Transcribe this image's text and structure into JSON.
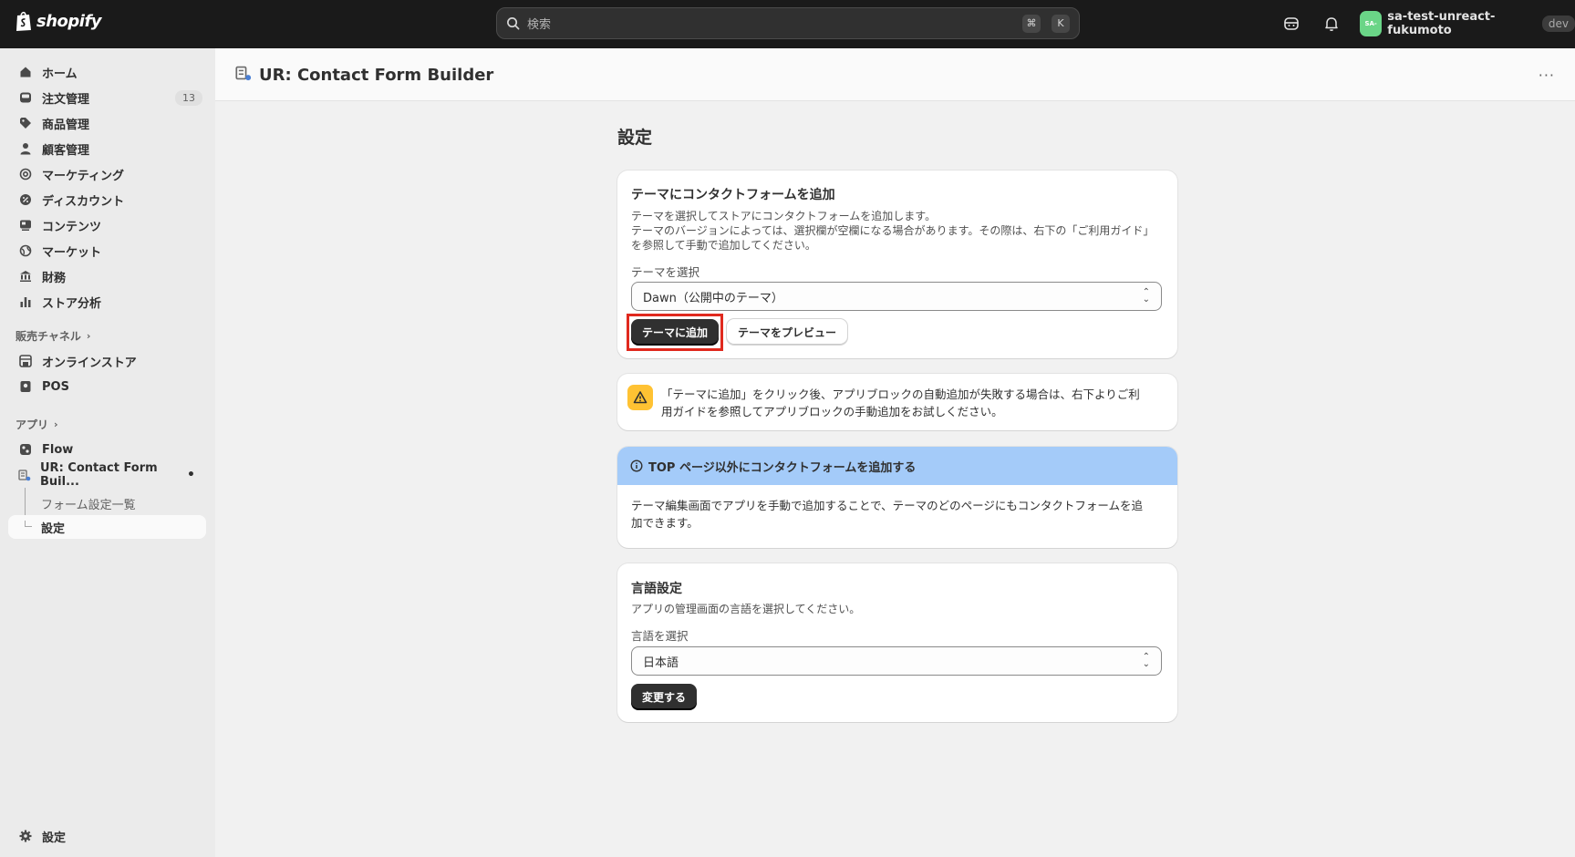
{
  "topbar": {
    "logo_text": "shopify",
    "search_placeholder": "検索",
    "shortcut_key1": "⌘",
    "shortcut_key2": "K",
    "avatar_initials": "SA-",
    "store_name": "sa-test-unreact-fukumoto",
    "env_badge": "dev"
  },
  "sidebar": {
    "items": [
      {
        "label": "ホーム",
        "icon": "home-icon"
      },
      {
        "label": "注文管理",
        "icon": "inbox-icon",
        "badge": "13"
      },
      {
        "label": "商品管理",
        "icon": "tag-icon"
      },
      {
        "label": "顧客管理",
        "icon": "person-icon"
      },
      {
        "label": "マーケティング",
        "icon": "target-icon"
      },
      {
        "label": "ディスカウント",
        "icon": "discount-icon"
      },
      {
        "label": "コンテンツ",
        "icon": "content-icon"
      },
      {
        "label": "マーケット",
        "icon": "globe-icon"
      },
      {
        "label": "財務",
        "icon": "bank-icon"
      },
      {
        "label": "ストア分析",
        "icon": "chart-bar-icon"
      }
    ],
    "sales_channels_label": "販売チャネル",
    "channels": [
      {
        "label": "オンラインストア",
        "icon": "store-icon"
      },
      {
        "label": "POS",
        "icon": "pos-icon"
      }
    ],
    "apps_label": "アプリ",
    "apps": [
      {
        "label": "Flow",
        "icon": "flow-icon"
      },
      {
        "label": "UR: Contact Form Buil...",
        "icon": "app-icon"
      }
    ],
    "app_sub_items": [
      "フォーム設定一覧",
      "設定"
    ],
    "settings_label": "設定"
  },
  "header": {
    "app_title": "UR: Contact Form Builder",
    "more": "···"
  },
  "main": {
    "page_title": "設定",
    "theme_card": {
      "title": "テーマにコンタクトフォームを追加",
      "desc_line1": "テーマを選択してストアにコンタクトフォームを追加します。",
      "desc_line2": "テーマのバージョンによっては、選択欄が空欄になる場合があります。その際は、右下の「ご利用ガイド」",
      "desc_line3": "を参照して手動で追加してください。",
      "select_label": "テーマを選択",
      "select_value": "Dawn（公開中のテーマ）",
      "add_button": "テーマに追加",
      "preview_button": "テーマをプレビュー"
    },
    "warning_card": {
      "line1": "「テーマに追加」をクリック後、アプリブロックの自動追加が失敗する場合は、右下よりご利",
      "line2": "用ガイドを参照してアプリブロックの手動追加をお試しください。"
    },
    "info_card": {
      "heading": "TOP ページ以外にコンタクトフォームを追加する",
      "line1": "テーマ編集画面でアプリを手動で追加することで、テーマのどのページにもコンタクトフォームを追",
      "line2": "加できます。"
    },
    "language_card": {
      "title": "言語設定",
      "desc": "アプリの管理画面の言語を選択してください。",
      "select_label": "言語を選択",
      "select_value": "日本語",
      "change_button": "変更する"
    }
  },
  "colors": {
    "topbar_bg": "#1a1a1a",
    "info_banner_bg": "#a4cbf9",
    "warning_icon_bg": "#ffc233",
    "highlight_border": "#e0291e",
    "primary_button_bg": "#303030"
  }
}
